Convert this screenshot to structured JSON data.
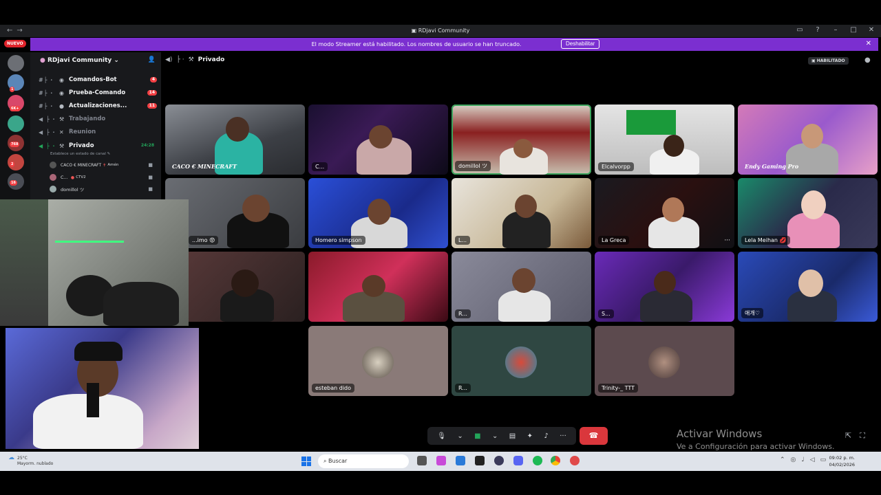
{
  "window": {
    "title": "RDjavi Community"
  },
  "banner": {
    "text": "El modo Streamer está habilitado. Los nombres de usuario se han truncado.",
    "button": "Deshabilitar"
  },
  "new_badge": "NUEVO",
  "rail_badges": [
    "1",
    "6K+",
    "768",
    "2",
    "16"
  ],
  "server": {
    "name": "RDjavi Community"
  },
  "channels": [
    {
      "name": "Comandos-Bot",
      "badge": "4"
    },
    {
      "name": "Prueba-Comando",
      "badge": "14"
    },
    {
      "name": "Actualizaciones...",
      "badge": "11"
    },
    {
      "name": "Trabajando"
    },
    {
      "name": "Reunion"
    },
    {
      "name": "Privado",
      "time": "24:28"
    }
  ],
  "channel_status_placeholder": "Establece un estado de canal",
  "voice_users": [
    {
      "name": "CACO € MINECRAFT",
      "tag": "Amén"
    },
    {
      "name": "C...",
      "tag": "CTV2"
    },
    {
      "name": "domillol ツ"
    }
  ],
  "voice_header": {
    "channel": "Privado",
    "streamer_badge": "HABILITADO"
  },
  "tiles": [
    {
      "label": "CACO € MINECRAFT"
    },
    {
      "label": "C..."
    },
    {
      "label": "domillol ツ"
    },
    {
      "label": "Elcalvorpp"
    },
    {
      "label": "Endy Gaming Pro"
    },
    {
      "label": "...imo 😡"
    },
    {
      "label": "Homero simpson"
    },
    {
      "label": "L..."
    },
    {
      "label": "La Greca"
    },
    {
      "label": "Lela Meihan 💋"
    },
    {
      "label": ""
    },
    {
      "label": ""
    },
    {
      "label": "R..."
    },
    {
      "label": "S..."
    },
    {
      "label": "애개♡"
    },
    {
      "label": "esteban dido"
    },
    {
      "label": "R..."
    },
    {
      "label": "Trinity-_ TTT"
    }
  ],
  "watermark": {
    "line1": "Activar Windows",
    "line2": "Ve a Configuración para activar Windows."
  },
  "taskbar": {
    "temp": "25°C",
    "weather": "Mayorm. nublado",
    "search_placeholder": "Buscar",
    "time": "09:02 p. m.",
    "date": "04/02/2026"
  },
  "icons": {
    "back": "arrow-left-icon",
    "mic": "microphone-icon",
    "camera": "camera-icon",
    "screen": "screen-share-icon",
    "activity": "activities-icon",
    "soundboard": "soundboard-icon",
    "more": "more-icon",
    "hangup": "phone-hangup-icon"
  },
  "colors": {
    "banner": "#7b2fd0",
    "speaking": "#3ba55d",
    "hangup": "#da373c",
    "badge": "#f23f43"
  }
}
